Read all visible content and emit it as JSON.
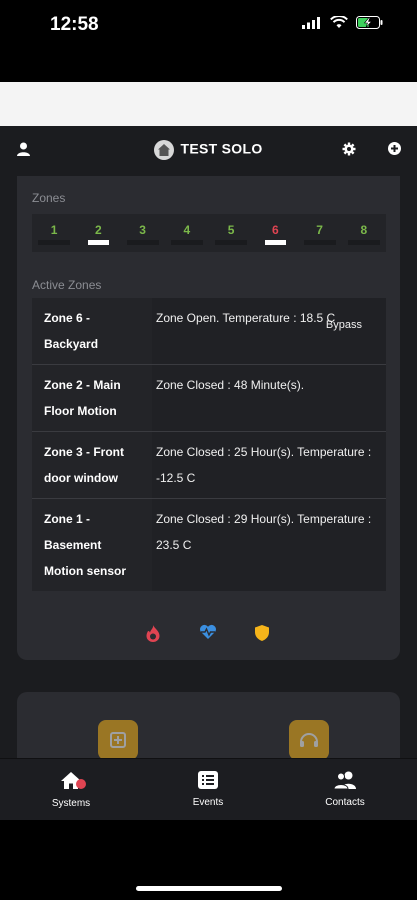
{
  "status_bar": {
    "time": "12:58"
  },
  "header": {
    "title": "TEST SOLO"
  },
  "zones_section": {
    "label": "Zones",
    "zones": [
      {
        "number": "1",
        "color": "#7bb84a",
        "active_bar": false
      },
      {
        "number": "2",
        "color": "#7bb84a",
        "active_bar": true
      },
      {
        "number": "3",
        "color": "#7bb84a",
        "active_bar": false
      },
      {
        "number": "4",
        "color": "#7bb84a",
        "active_bar": false
      },
      {
        "number": "5",
        "color": "#7bb84a",
        "active_bar": false
      },
      {
        "number": "6",
        "color": "#e04452",
        "active_bar": true
      },
      {
        "number": "7",
        "color": "#7bb84a",
        "active_bar": false
      },
      {
        "number": "8",
        "color": "#7bb84a",
        "active_bar": false
      }
    ]
  },
  "active_zones": {
    "label": "Active Zones",
    "rows": [
      {
        "name": "Zone 6 - Backyard",
        "status": "Zone Open. Temperature : 18.5 C",
        "action": "Bypass"
      },
      {
        "name": "Zone 2 - Main Floor Motion",
        "status": "Zone Closed : 48 Minute(s).",
        "action": ""
      },
      {
        "name": "Zone 3 - Front door window",
        "status": "Zone Closed : 25 Hour(s). Temperature : -12.5 C",
        "action": ""
      },
      {
        "name": "Zone 1 - Basement Motion sensor",
        "status": "Zone Closed : 29 Hour(s). Temperature : 23.5 C",
        "action": ""
      }
    ]
  },
  "status_icons": {
    "fire_color": "#e04452",
    "medical_color": "#3b8fe0",
    "police_color": "#f5b41a"
  },
  "nav": {
    "systems": "Systems",
    "events": "Events",
    "contacts": "Contacts"
  },
  "colors": {
    "background": "#1b1c1f",
    "card": "#2b2c31",
    "accent": "#f5b41a"
  }
}
